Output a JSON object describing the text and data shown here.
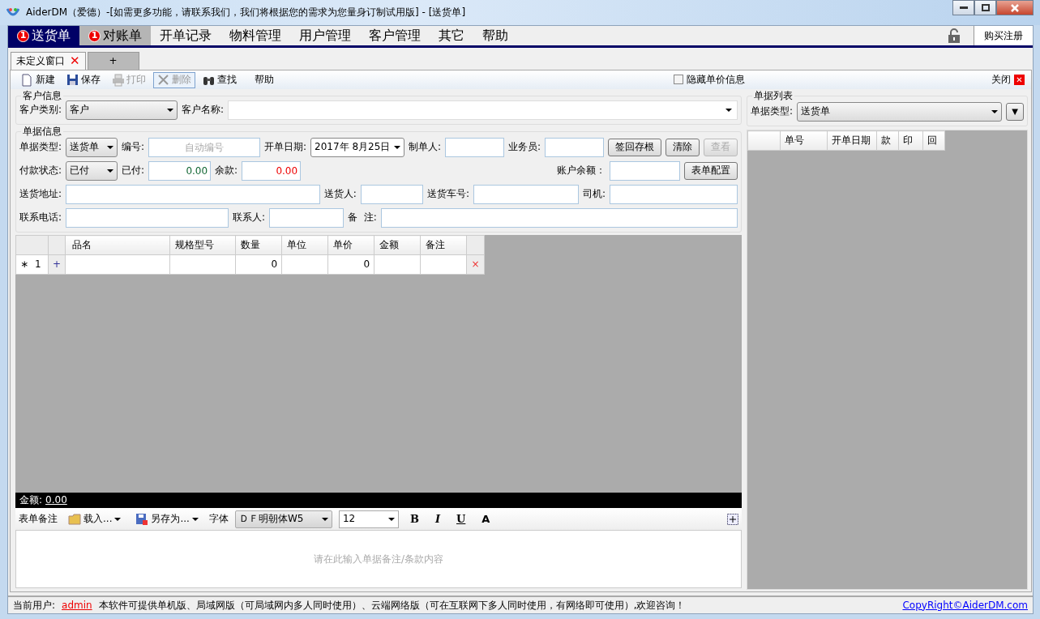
{
  "window": {
    "title": "AiderDM（爱德）-[如需更多功能，请联系我们，我们将根据您的需求为您量身订制试用版] - [送货单]"
  },
  "menu": {
    "items": [
      {
        "label": "送货单",
        "badge": "1",
        "selected": true,
        "hovered": false
      },
      {
        "label": "对账单",
        "badge": "1",
        "selected": false,
        "hovered": true
      },
      {
        "label": "开单记录",
        "selected": false,
        "hovered": false
      },
      {
        "label": "物料管理",
        "selected": false,
        "hovered": false
      },
      {
        "label": "用户管理",
        "selected": false,
        "hovered": false
      },
      {
        "label": "客户管理",
        "selected": false,
        "hovered": false
      },
      {
        "label": "其它",
        "selected": false,
        "hovered": false
      },
      {
        "label": "帮助",
        "selected": false,
        "hovered": false
      }
    ],
    "register": "购买注册"
  },
  "doc_tabs": [
    {
      "label": "未定义窗口",
      "selected": true,
      "close": "✕"
    },
    {
      "label": "+",
      "selected": false
    }
  ],
  "toolbar": {
    "buttons": [
      {
        "label": "新建",
        "disabled": false,
        "hovered": false
      },
      {
        "label": "保存",
        "disabled": false,
        "hovered": false
      },
      {
        "label": "打印",
        "disabled": true,
        "hovered": false
      },
      {
        "label": "删除",
        "disabled": true,
        "hovered": true
      },
      {
        "label": "查找",
        "disabled": false,
        "hovered": false
      },
      {
        "label": "帮助",
        "disabled": false,
        "hovered": false
      }
    ],
    "hide_price": {
      "label": "隐藏单价信息",
      "checked": false
    },
    "close": "关闭",
    "close_glyph": "✕"
  },
  "customer": {
    "title": "客户信息",
    "fields": [
      {
        "label": "客户类别:",
        "kind": "select",
        "value": "客户"
      },
      {
        "label": "客户名称:",
        "kind": "combo"
      }
    ]
  },
  "document": {
    "title": "单据信息",
    "lines": [
      {
        "fields": [
          {
            "label": "单据类型:",
            "kind": "select",
            "value": "送货单"
          },
          {
            "label": "编号:",
            "kind": "input",
            "placeholder": "自动编号"
          },
          {
            "label": "开单日期:",
            "kind": "date",
            "value": "2017年  8月25日"
          },
          {
            "label": "制单人:",
            "kind": "input"
          },
          {
            "label": "业务员:",
            "kind": "input"
          },
          {
            "kind": "button",
            "text": "签回存根",
            "disabled": false
          },
          {
            "kind": "button",
            "text": "清除",
            "disabled": false
          },
          {
            "kind": "button",
            "text": "查看",
            "disabled": true
          }
        ]
      },
      {
        "fields": [
          {
            "label": "付款状态:",
            "kind": "select",
            "value": "已付"
          },
          {
            "label": "已付:",
            "kind": "input",
            "value": "0.00",
            "color": "#116633"
          },
          {
            "label": "余款:",
            "kind": "input",
            "value": "0.00",
            "color": "#ee0000"
          },
          {
            "label": "账户余额：",
            "kind": "input"
          },
          {
            "kind": "button",
            "text": "表单配置",
            "disabled": false
          }
        ]
      },
      {
        "fields": [
          {
            "label": "送货地址:",
            "kind": "input"
          },
          {
            "label": "送货人:",
            "kind": "input"
          },
          {
            "label": "送货车号:",
            "kind": "input"
          },
          {
            "label": "司机:",
            "kind": "input"
          }
        ]
      },
      {
        "fields": [
          {
            "label": "联系电话:",
            "kind": "input"
          },
          {
            "label": "联系人:",
            "kind": "input"
          },
          {
            "label": "备  注:",
            "kind": "input"
          }
        ]
      }
    ]
  },
  "grid": {
    "columns": [
      "品名",
      "规格型号",
      "数量",
      "单位",
      "单价",
      "金额",
      "备注"
    ],
    "rows": [
      {
        "marker": "∗",
        "number": "1",
        "add": "+",
        "cells": [
          null,
          null,
          "0",
          null,
          "0",
          null,
          null
        ],
        "delete": "×"
      }
    ]
  },
  "total": {
    "label": "金额:",
    "value": "0.00"
  },
  "editor": {
    "items": [
      {
        "kind": "label",
        "text": "表单备注"
      },
      {
        "kind": "menu",
        "text": "载入..."
      },
      {
        "kind": "menu",
        "text": "另存为..."
      },
      {
        "kind": "label",
        "text": "字体"
      },
      {
        "kind": "select",
        "value": "ＤＦ明朝体W5"
      },
      {
        "kind": "select",
        "value": "12"
      },
      {
        "kind": "format",
        "text": "B"
      },
      {
        "kind": "format",
        "text": "I"
      },
      {
        "kind": "format",
        "text": "U"
      },
      {
        "kind": "format",
        "text": "A"
      }
    ],
    "placeholder": "请在此输入单据备注/条款内容"
  },
  "list_panel": {
    "title": "单据列表",
    "filter_label": "单据类型:",
    "filter_value": "送货单",
    "button": "▼",
    "columns": [
      "单号",
      "开单日期",
      "款",
      "印",
      "回"
    ]
  },
  "status_bar": {
    "user_label": "当前用户:",
    "user": "admin",
    "message": "本软件可提供单机版、局域网版（可局域网内多人同时使用）、云端网络版（可在互联网下多人同时使用，有网络即可使用）,欢迎咨询！",
    "copyright": "CopyRight©AiderDM.com"
  }
}
